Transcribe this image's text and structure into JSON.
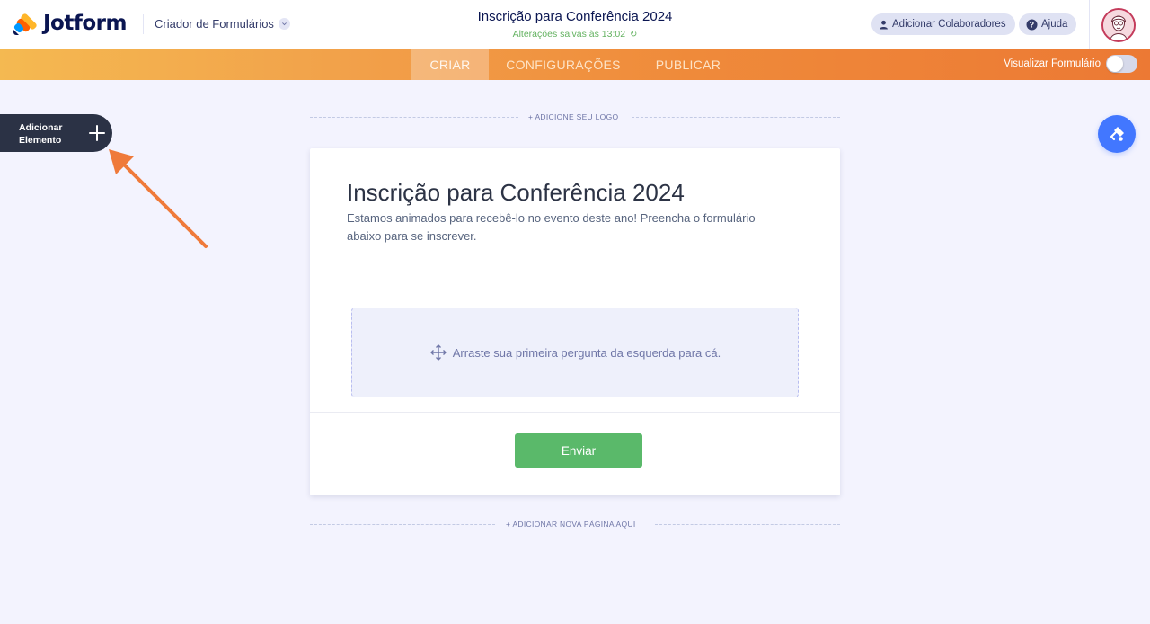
{
  "header": {
    "brand": "Jotform",
    "builder_menu": "Criador de Formulários",
    "form_title": "Inscrição para Conferência 2024",
    "save_status": "Alterações salvas às 13:02",
    "add_collaborators": "Adicionar Colaboradores",
    "help": "Ajuda"
  },
  "nav": {
    "tabs": [
      {
        "label": "CRIAR",
        "active": true
      },
      {
        "label": "CONFIGURAÇÕES",
        "active": false
      },
      {
        "label": "PUBLICAR",
        "active": false
      }
    ],
    "preview_label": "Visualizar Formulário",
    "preview_on": false
  },
  "sidebar": {
    "add_element": "Adicionar Elemento"
  },
  "canvas": {
    "add_logo": "+ ADICIONE SEU LOGO",
    "add_page": "+ ADICIONAR NOVA PÁGINA AQUI"
  },
  "form": {
    "title": "Inscrição para Conferência 2024",
    "description": "Estamos animados para recebê-lo no evento deste ano! Preencha o formulário abaixo para se inscrever.",
    "dropzone_text": "Arraste sua primeira pergunta da esquerda para cá.",
    "submit_label": "Enviar"
  },
  "colors": {
    "accent_orange": "#ec7934",
    "submit_green": "#5ab96a",
    "designer_blue": "#4277ff",
    "add_element_bg": "#2b3245",
    "annotation_arrow": "#ef7a3a"
  }
}
